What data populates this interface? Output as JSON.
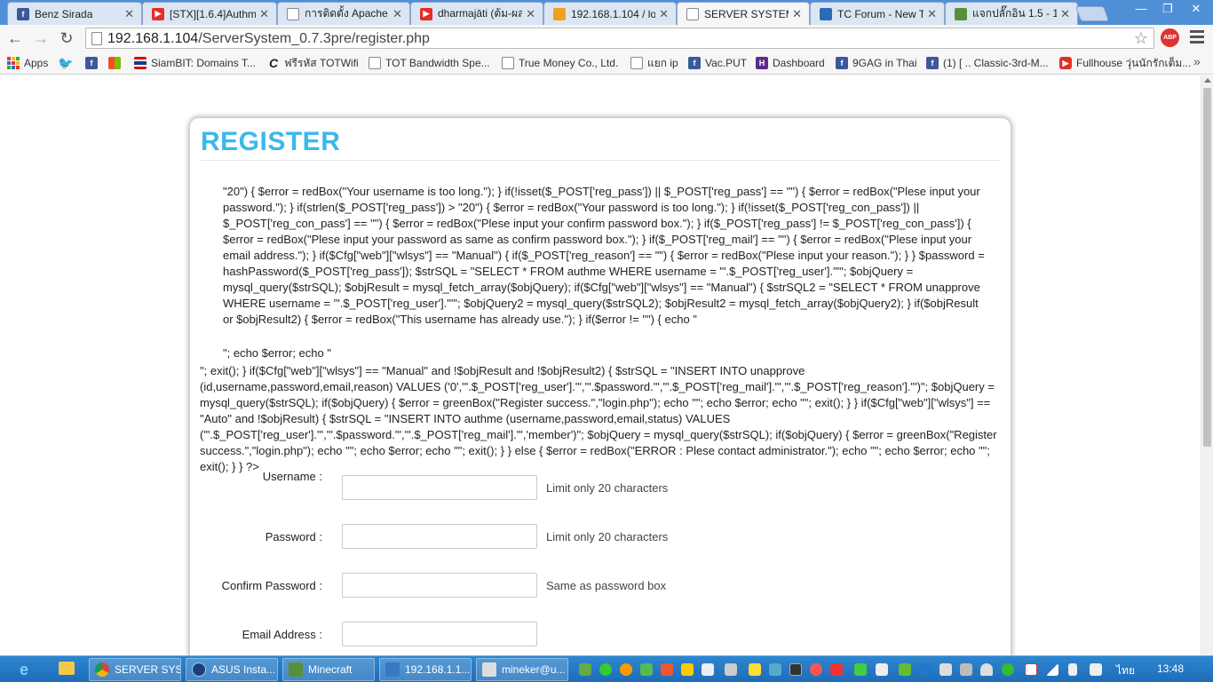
{
  "tabs": [
    {
      "title": "Benz Sirada",
      "icon": "facebook-icon",
      "color": "#3b5998"
    },
    {
      "title": "[STX][1.6.4]Authme",
      "icon": "youtube-icon",
      "color": "#e52d27"
    },
    {
      "title": "การติดตั้ง Apache, F",
      "icon": "page-icon",
      "color": "#ffffff"
    },
    {
      "title": "dharmajāti (ต้ม-ผส",
      "icon": "youtube-icon",
      "color": "#e52d27"
    },
    {
      "title": "192.168.1.104 / loc",
      "icon": "phpmyadmin-icon",
      "color": "#f0a020"
    },
    {
      "title": "SERVER SYSTEM :",
      "icon": "page-icon",
      "color": "#ffffff"
    },
    {
      "title": "TC Forum - New T",
      "icon": "forum-icon",
      "color": "#2a6bb8"
    },
    {
      "title": "แจกปลั๊กอิน 1.5 - 1.7",
      "icon": "minecraft-icon",
      "color": "#5a8f3a"
    }
  ],
  "window_controls": {
    "minimize": "—",
    "maximize": "❐",
    "close": "✕"
  },
  "toolbar": {
    "back": "←",
    "forward": "→",
    "reload": "↻",
    "url_host": "192.168.1.104",
    "url_path": "/ServerSystem_0.7.3pre/register.php",
    "star": "☆",
    "abp": "ABP"
  },
  "bookmarks": [
    {
      "label": "Apps",
      "icon": "apps-icon"
    },
    {
      "label": "",
      "icon": "twitter-icon"
    },
    {
      "label": "",
      "icon": "facebook-icon"
    },
    {
      "label": "",
      "icon": "microsoft-icon"
    },
    {
      "label": "SiamBIT: Domains T...",
      "icon": "thai-flag-icon"
    },
    {
      "label": "ฟรีรหัส TOTWifi",
      "icon": "c-icon"
    },
    {
      "label": "TOT Bandwidth Spe...",
      "icon": "page-icon"
    },
    {
      "label": "True Money Co., Ltd.",
      "icon": "page-icon"
    },
    {
      "label": "แยก ip",
      "icon": "page-icon"
    },
    {
      "label": "Vac.PUT",
      "icon": "facebook-icon"
    },
    {
      "label": "Dashboard",
      "icon": "h-icon"
    },
    {
      "label": "9GAG in Thai",
      "icon": "facebook-icon"
    },
    {
      "label": "(1) [ .. Classic-3rd-M...",
      "icon": "facebook-icon"
    },
    {
      "label": "Fullhouse วุ่นนักรักเต็ม...",
      "icon": "youtube-icon"
    }
  ],
  "bookmarks_overflow": "»",
  "page": {
    "heading": "REGISTER",
    "code_indented": "\"20\") { $error = redBox(\"Your username is too long.\"); } if(!isset($_POST['reg_pass']) || $_POST['reg_pass'] == \"\") { $error = redBox(\"Plese input your password.\"); } if(strlen($_POST['reg_pass']) > \"20\") { $error = redBox(\"Your password is too long.\"); } if(!isset($_POST['reg_con_pass']) || $_POST['reg_con_pass'] == \"\") { $error = redBox(\"Plese input your confirm password box.\"); } if($_POST['reg_pass'] != $_POST['reg_con_pass']) { $error = redBox(\"Plese input your password as same as confirm password box.\"); } if($_POST['reg_mail'] == \"\") { $error = redBox(\"Plese input your email address.\"); } if($Cfg[\"web\"][\"wlsys\"] == \"Manual\") { if($_POST['reg_reason'] == \"\") { $error = redBox(\"Plese input your reason.\"); } } $password = hashPassword($_POST['reg_pass']); $strSQL = \"SELECT * FROM authme WHERE username = '\".$_POST['reg_user'].\"'\"; $objQuery = mysql_query($strSQL); $objResult = mysql_fetch_array($objQuery); if($Cfg[\"web\"][\"wlsys\"] == \"Manual\") { $strSQL2 = \"SELECT * FROM unapprove WHERE username = '\".$_POST['reg_user'].\"'\"; $objQuery2 = mysql_query($strSQL2); $objResult2 = mysql_fetch_array($objQuery2); } if($objResult or $objResult2) { $error = redBox(\"This username has already use.\"); } if($error != \"\") { echo \"",
    "code_fragment": "\"; echo $error; echo \"",
    "code_full": "\"; exit(); } if($Cfg[\"web\"][\"wlsys\"] == \"Manual\" and !$objResult and !$objResult2) { $strSQL = \"INSERT INTO unapprove (id,username,password,email,reason) VALUES ('0','\".$_POST['reg_user'].\"','\".$password.\"','\".$_POST['reg_mail'].\"','\".$_POST['reg_reason'].\"')\"; $objQuery = mysql_query($strSQL); if($objQuery) { $error = greenBox(\"Register success.\",\"login.php\"); echo \"\"; echo $error; echo \"\"; exit(); } } if($Cfg[\"web\"][\"wlsys\"] == \"Auto\" and !$objResult) { $strSQL = \"INSERT INTO authme (username,password,email,status) VALUES ('\".$_POST['reg_user'].\"','\".$password.\"','\".$_POST['reg_mail'].\"','member')\"; $objQuery = mysql_query($strSQL); if($objQuery) { $error = greenBox(\"Register success.\",\"login.php\"); echo \"\"; echo $error; echo \"\"; exit(); } } else { $error = redBox(\"ERROR : Plese contact administrator.\"); echo \"\"; echo $error; echo \"\"; exit(); } } ?>",
    "form": [
      {
        "label": "Username :",
        "value": "",
        "hint": "Limit only 20 characters"
      },
      {
        "label": "Password :",
        "value": "",
        "hint": "Limit only 20 characters"
      },
      {
        "label": "Confirm Password :",
        "value": "",
        "hint": "Same as password box"
      },
      {
        "label": "Email Address :",
        "value": "",
        "hint": ""
      }
    ]
  },
  "taskbar": {
    "items": [
      {
        "label": "SERVER SYS...",
        "icon": "chrome-icon"
      },
      {
        "label": "ASUS Insta...",
        "icon": "asus-icon"
      },
      {
        "label": "Minecraft",
        "icon": "minecraft-icon"
      },
      {
        "label": "192.168.1.1...",
        "icon": "remote-desktop-icon"
      },
      {
        "label": "mineker@u...",
        "icon": "putty-icon"
      }
    ],
    "language": "ไทย",
    "clock": "13:48"
  }
}
